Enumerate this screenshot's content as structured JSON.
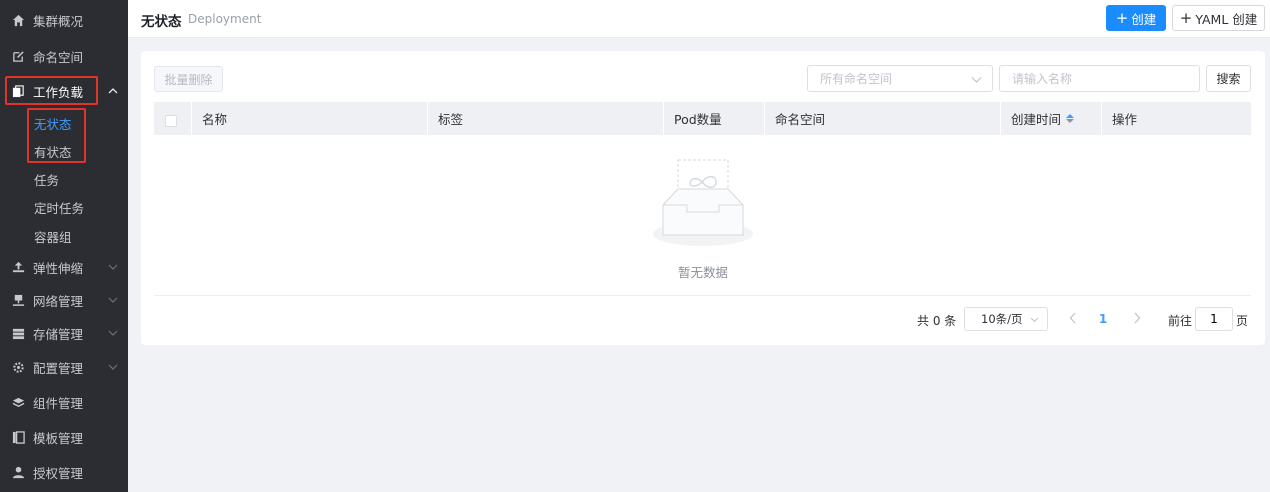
{
  "sidebar": {
    "items": [
      {
        "label": "集群概况",
        "icon": "home-icon"
      },
      {
        "label": "命名空间",
        "icon": "edit-icon"
      },
      {
        "label": "工作负载",
        "icon": "copy-icon"
      },
      {
        "label": "弹性伸缩",
        "icon": "scale-icon"
      },
      {
        "label": "网络管理",
        "icon": "network-icon"
      },
      {
        "label": "存储管理",
        "icon": "storage-icon"
      },
      {
        "label": "配置管理",
        "icon": "gear-icon"
      },
      {
        "label": "组件管理",
        "icon": "layers-icon"
      },
      {
        "label": "模板管理",
        "icon": "template-icon"
      },
      {
        "label": "授权管理",
        "icon": "user-icon"
      }
    ],
    "workload_sub": [
      "无状态",
      "有状态",
      "任务",
      "定时任务",
      "容器组"
    ]
  },
  "header": {
    "title": "无状态",
    "subtitle": "Deployment",
    "create_label": "创建",
    "yaml_label": "YAML 创建"
  },
  "toolbar": {
    "batch_delete": "批量删除",
    "namespace_placeholder": "所有命名空间",
    "name_placeholder": "请输入名称",
    "search_label": "搜索"
  },
  "table": {
    "columns": [
      "名称",
      "标签",
      "Pod数量",
      "命名空间",
      "创建时间",
      "操作"
    ],
    "rows": [],
    "empty_text": "暂无数据"
  },
  "pagination": {
    "total": "共 0 条",
    "page_size": "10条/页",
    "current": "1",
    "goto_label": "前往",
    "goto_value": "1",
    "page_suffix": "页"
  },
  "colors": {
    "sidebar_bg": "#2b2d33",
    "primary": "#1a8cff",
    "highlight_box": "#e0352b"
  }
}
